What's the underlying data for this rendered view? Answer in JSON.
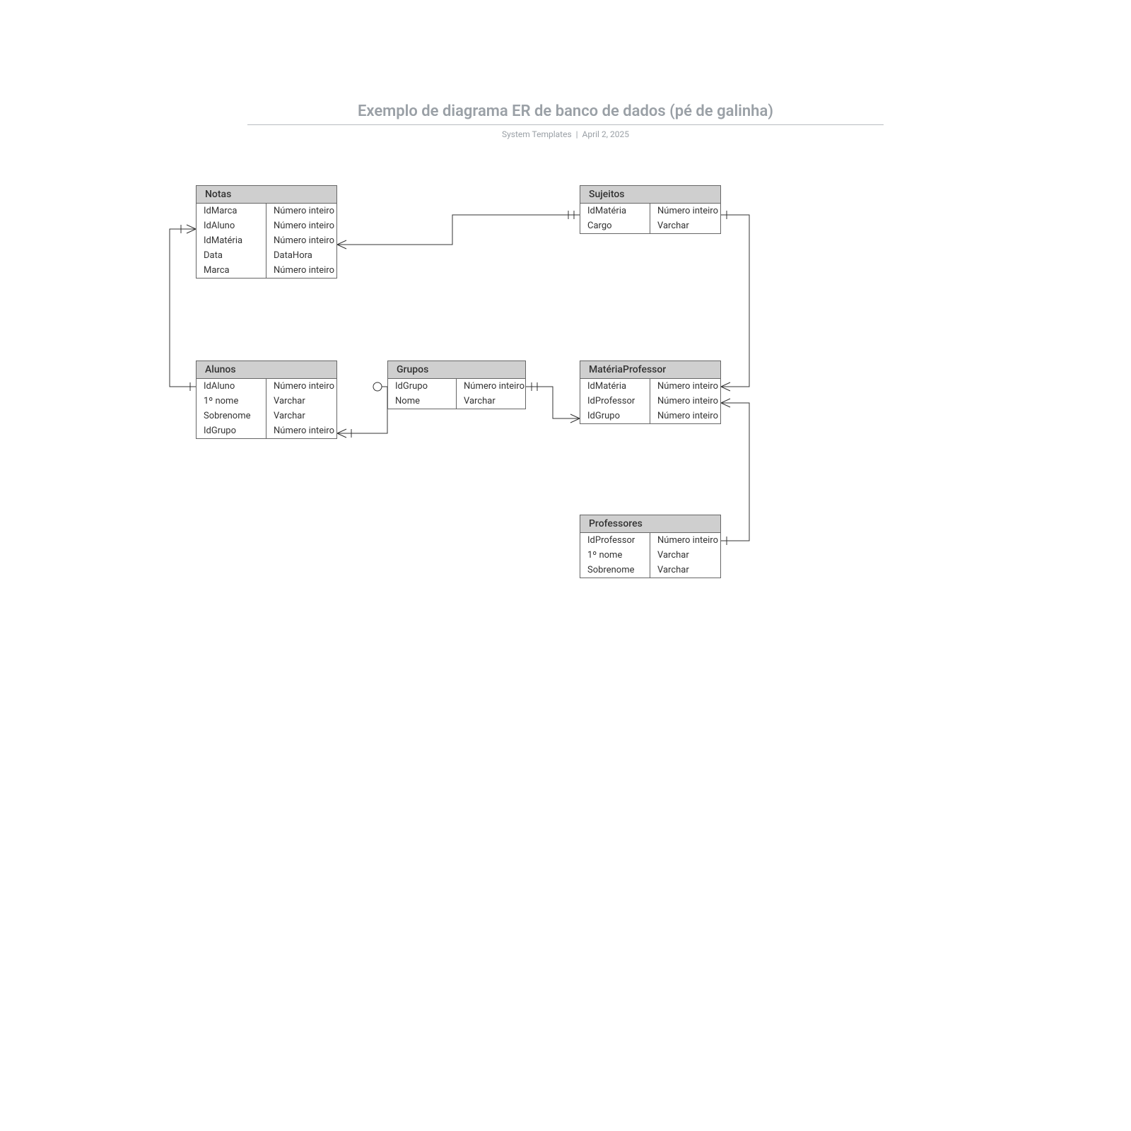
{
  "title": "Exemplo de diagrama ER de banco de dados (pé de galinha)",
  "subtitle_author": "System Templates",
  "subtitle_date": "April 2, 2025",
  "entities": {
    "notas": {
      "name": "Notas",
      "fields": [
        {
          "k": "IdMarca",
          "t": "Número inteiro"
        },
        {
          "k": "IdAluno",
          "t": "Número inteiro"
        },
        {
          "k": "IdMatéria",
          "t": "Número inteiro"
        },
        {
          "k": "Data",
          "t": "DataHora"
        },
        {
          "k": "Marca",
          "t": "Número inteiro"
        }
      ]
    },
    "sujeitos": {
      "name": "Sujeitos",
      "fields": [
        {
          "k": "IdMatéria",
          "t": "Número inteiro"
        },
        {
          "k": "Cargo",
          "t": "Varchar"
        }
      ]
    },
    "alunos": {
      "name": "Alunos",
      "fields": [
        {
          "k": "IdAluno",
          "t": "Número inteiro"
        },
        {
          "k": "1º nome",
          "t": "Varchar"
        },
        {
          "k": "Sobrenome",
          "t": "Varchar"
        },
        {
          "k": "IdGrupo",
          "t": "Número inteiro"
        }
      ]
    },
    "grupos": {
      "name": "Grupos",
      "fields": [
        {
          "k": "IdGrupo",
          "t": "Número inteiro"
        },
        {
          "k": "Nome",
          "t": "Varchar"
        }
      ]
    },
    "materiaProfessor": {
      "name": "MatériaProfessor",
      "fields": [
        {
          "k": "IdMatéria",
          "t": "Número inteiro"
        },
        {
          "k": "IdProfessor",
          "t": "Número inteiro"
        },
        {
          "k": "IdGrupo",
          "t": "Número inteiro"
        }
      ]
    },
    "professores": {
      "name": "Professores",
      "fields": [
        {
          "k": "IdProfessor",
          "t": "Número inteiro"
        },
        {
          "k": "1º nome",
          "t": "Varchar"
        },
        {
          "k": "Sobrenome",
          "t": "Varchar"
        }
      ]
    }
  }
}
